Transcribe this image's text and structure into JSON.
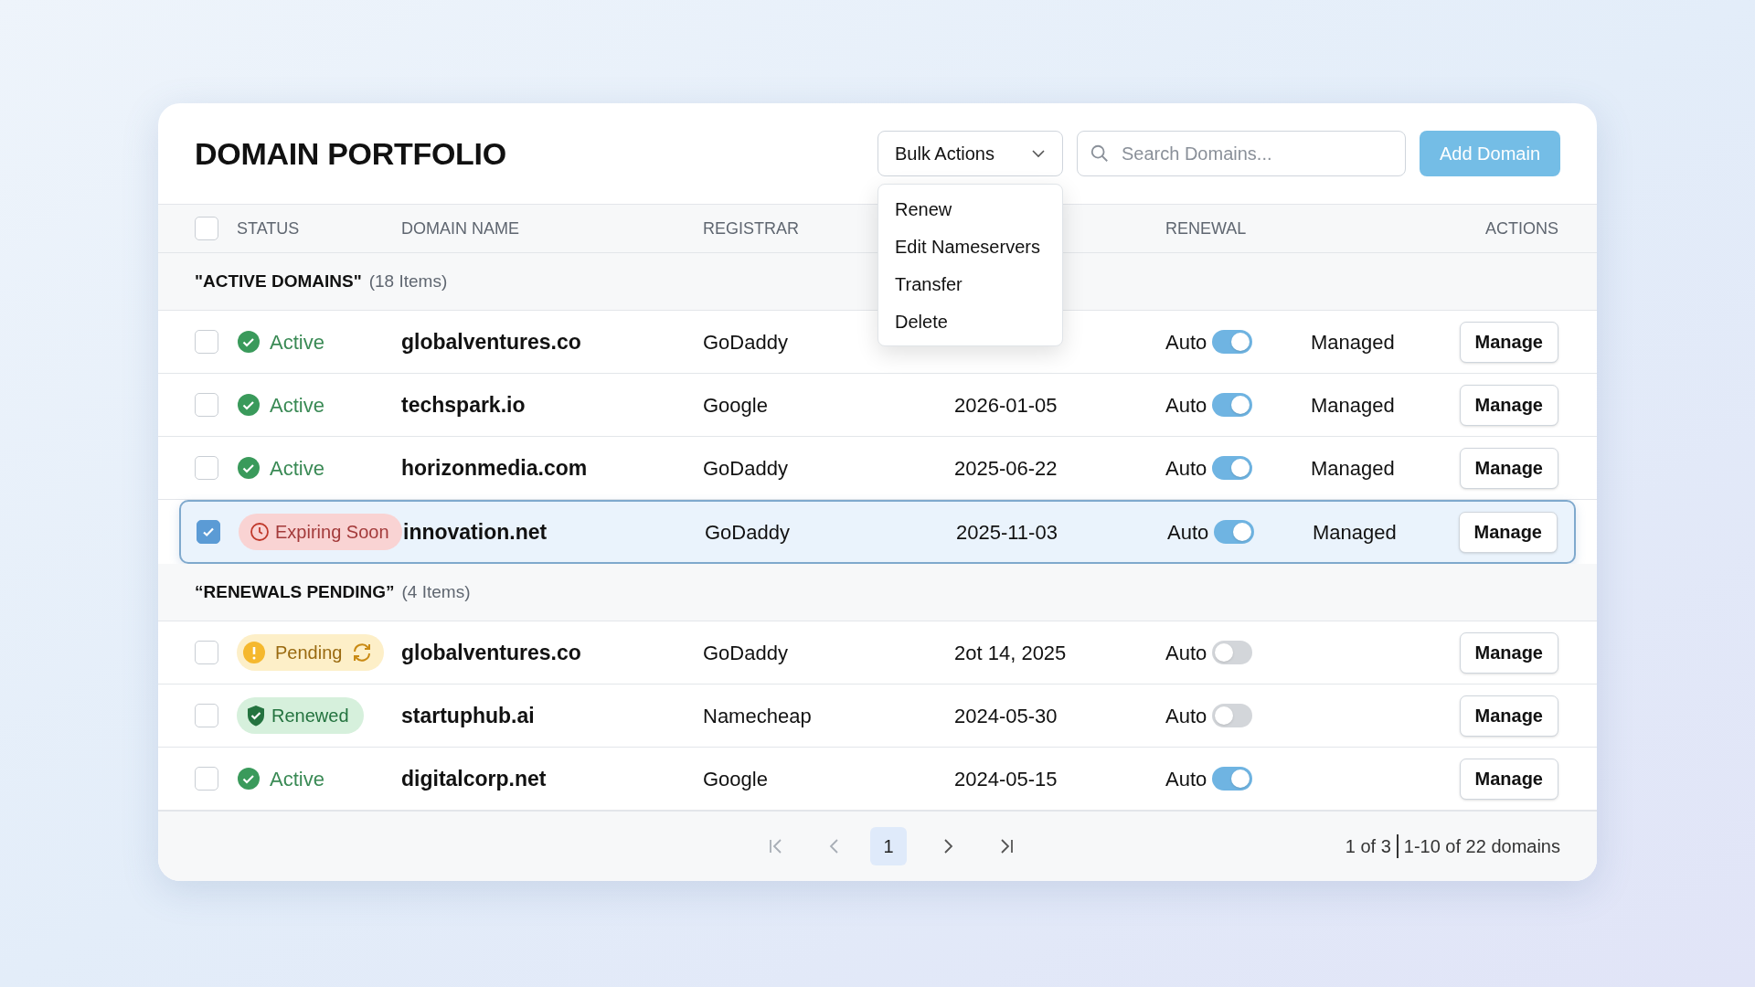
{
  "title": "DOMAIN PORTFOLIO",
  "bulk_actions": {
    "label": "Bulk Actions",
    "expanded": true,
    "menu": [
      "Renew",
      "Edit Nameservers",
      "Transfer",
      "Delete"
    ]
  },
  "search": {
    "placeholder": "Search Domains..."
  },
  "add_button": "Add Domain",
  "header": {
    "select_all_checked": false,
    "status": "STATUS",
    "domain": "DOMAIN NAME",
    "registrar": "REGISTRAR",
    "renewal": "RENEWAL",
    "actions": "ACTIONS"
  },
  "groups": [
    {
      "title": "\"ACTIVE DOMAINS\"",
      "count": "(18 Items)",
      "rows": [
        {
          "checked": false,
          "selected": false,
          "status": {
            "kind": "active",
            "label": "Active"
          },
          "domain": "globalventures.co",
          "registrar": "GoDaddy",
          "renewal": "Auto",
          "auto_renew": true,
          "management": "Managed",
          "action": "Manage"
        },
        {
          "checked": false,
          "selected": false,
          "status": {
            "kind": "active",
            "label": "Active"
          },
          "domain": "techspark.io",
          "registrar": "Google",
          "expiry": "2026-01-05",
          "renewal": "Auto",
          "auto_renew": true,
          "management": "Managed",
          "action": "Manage"
        },
        {
          "checked": false,
          "selected": false,
          "status": {
            "kind": "active",
            "label": "Active"
          },
          "domain": "horizonmedia.com",
          "registrar": "GoDaddy",
          "expiry": "2025-06-22",
          "renewal": "Auto",
          "auto_renew": true,
          "management": "Managed",
          "action": "Manage"
        },
        {
          "checked": true,
          "selected": true,
          "status": {
            "kind": "expiring",
            "label": "Expiring Soon"
          },
          "domain": "innovation.net",
          "registrar": "GoDaddy",
          "expiry": "2025-11-03",
          "renewal": "Auto",
          "auto_renew": true,
          "management": "Managed",
          "action": "Manage"
        }
      ]
    },
    {
      "title": "“RENEWALS PENDING”",
      "count": "(4 Items)",
      "rows": [
        {
          "checked": false,
          "selected": false,
          "status": {
            "kind": "pending",
            "label": "Pending"
          },
          "domain": "globalventures.co",
          "registrar": "GoDaddy",
          "expiry": "2ot 14, 2025",
          "renewal": "Auto",
          "auto_renew": false,
          "action": "Manage"
        },
        {
          "checked": false,
          "selected": false,
          "status": {
            "kind": "renewed",
            "label": "Renewed"
          },
          "domain": "startuphub.ai",
          "registrar": "Namecheap",
          "expiry": "2024-05-30",
          "renewal": "Auto",
          "auto_renew": false,
          "action": "Manage"
        },
        {
          "checked": false,
          "selected": false,
          "status": {
            "kind": "active",
            "label": "Active"
          },
          "domain": "digitalcorp.net",
          "registrar": "Google",
          "expiry": "2024-05-15",
          "renewal": "Auto",
          "auto_renew": true,
          "action": "Manage"
        }
      ]
    }
  ],
  "pagination": {
    "current_page": "1",
    "page_of": "1 of 3",
    "range": "1-10 of 22 domains"
  }
}
